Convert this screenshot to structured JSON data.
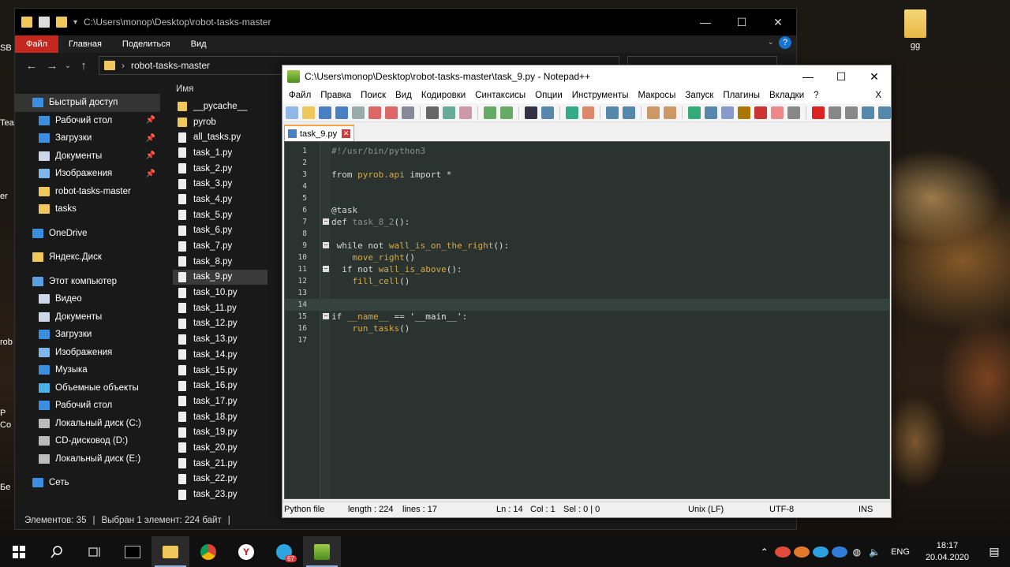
{
  "desktop": {
    "right_icon_label": "gg",
    "edge_labels": [
      "SB",
      "Tea",
      "er",
      "rob",
      "P",
      "Co",
      "Бе"
    ]
  },
  "explorer": {
    "title_path": "C:\\Users\\monop\\Desktop\\robot-tasks-master",
    "ribbon_tabs": [
      "Файл",
      "Главная",
      "Поделиться",
      "Вид"
    ],
    "help_label": "?",
    "address_path": "robot-tasks-master",
    "column_header": "Имя",
    "nav_items": [
      {
        "label": "Быстрый доступ",
        "icon": "star-icon",
        "type": "head",
        "selected": true
      },
      {
        "label": "Рабочий стол",
        "icon": "desktop-icon",
        "pinned": true
      },
      {
        "label": "Загрузки",
        "icon": "download-icon",
        "pinned": true
      },
      {
        "label": "Документы",
        "icon": "documents-icon",
        "pinned": true
      },
      {
        "label": "Изображения",
        "icon": "images-icon",
        "pinned": true
      },
      {
        "label": "robot-tasks-master",
        "icon": "folder-icon"
      },
      {
        "label": "tasks",
        "icon": "folder-icon"
      },
      {
        "label": "OneDrive",
        "icon": "cloud-icon",
        "type": "head",
        "gap": true
      },
      {
        "label": "Яндекс.Диск",
        "icon": "yandex-disk-icon",
        "type": "head",
        "gap": true
      },
      {
        "label": "Этот компьютер",
        "icon": "computer-icon",
        "type": "head",
        "gap": true
      },
      {
        "label": "Видео",
        "icon": "video-icon"
      },
      {
        "label": "Документы",
        "icon": "documents-icon"
      },
      {
        "label": "Загрузки",
        "icon": "download-icon"
      },
      {
        "label": "Изображения",
        "icon": "images-icon"
      },
      {
        "label": "Музыка",
        "icon": "music-icon"
      },
      {
        "label": "Объемные объекты",
        "icon": "3d-objects-icon"
      },
      {
        "label": "Рабочий стол",
        "icon": "desktop-icon"
      },
      {
        "label": "Локальный диск (C:)",
        "icon": "drive-icon"
      },
      {
        "label": "CD-дисковод (D:)",
        "icon": "cd-drive-icon"
      },
      {
        "label": "Локальный диск (E:)",
        "icon": "drive-icon"
      },
      {
        "label": "Сеть",
        "icon": "network-icon",
        "type": "head",
        "gap": true
      }
    ],
    "files": [
      {
        "name": "__pycache__",
        "type": "folder"
      },
      {
        "name": "pyrob",
        "type": "folder"
      },
      {
        "name": "all_tasks.py",
        "type": "file"
      },
      {
        "name": "task_1.py",
        "type": "file"
      },
      {
        "name": "task_2.py",
        "type": "file"
      },
      {
        "name": "task_3.py",
        "type": "file"
      },
      {
        "name": "task_4.py",
        "type": "file"
      },
      {
        "name": "task_5.py",
        "type": "file"
      },
      {
        "name": "task_6.py",
        "type": "file"
      },
      {
        "name": "task_7.py",
        "type": "file"
      },
      {
        "name": "task_8.py",
        "type": "file"
      },
      {
        "name": "task_9.py",
        "type": "file",
        "selected": true
      },
      {
        "name": "task_10.py",
        "type": "file"
      },
      {
        "name": "task_11.py",
        "type": "file"
      },
      {
        "name": "task_12.py",
        "type": "file"
      },
      {
        "name": "task_13.py",
        "type": "file"
      },
      {
        "name": "task_14.py",
        "type": "file"
      },
      {
        "name": "task_15.py",
        "type": "file"
      },
      {
        "name": "task_16.py",
        "type": "file"
      },
      {
        "name": "task_17.py",
        "type": "file"
      },
      {
        "name": "task_18.py",
        "type": "file"
      },
      {
        "name": "task_19.py",
        "type": "file"
      },
      {
        "name": "task_20.py",
        "type": "file"
      },
      {
        "name": "task_21.py",
        "type": "file"
      },
      {
        "name": "task_22.py",
        "type": "file"
      },
      {
        "name": "task_23.py",
        "type": "file"
      }
    ],
    "status_count": "Элементов: 35",
    "status_selected": "Выбран 1 элемент: 224 байт"
  },
  "npp": {
    "title": "C:\\Users\\monop\\Desktop\\robot-tasks-master\\task_9.py - Notepad++",
    "menu": [
      "Файл",
      "Правка",
      "Поиск",
      "Вид",
      "Кодировки",
      "Синтаксисы",
      "Опции",
      "Инструменты",
      "Макросы",
      "Запуск",
      "Плагины",
      "Вкладки",
      "?"
    ],
    "menu_close": "X",
    "tab_label": "task_9.py",
    "code_lines": [
      {
        "n": "1",
        "text": "#!/usr/bin/python3",
        "cls": "c-gray"
      },
      {
        "n": "2",
        "text": ""
      },
      {
        "n": "3",
        "text": "from pyrob.api import *",
        "html": "from <span class='c-fn'>pyrob.api</span> import *"
      },
      {
        "n": "4",
        "text": ""
      },
      {
        "n": "5",
        "text": ""
      },
      {
        "n": "6",
        "text": "@task"
      },
      {
        "n": "7",
        "text": "def task_8_2():",
        "fold": true,
        "html": "def <span class='c-gray'>task_8_2</span>():"
      },
      {
        "n": "8",
        "text": ""
      },
      {
        "n": "9",
        "text": " while not wall_is_on_the_right():",
        "fold": true,
        "html": " while not <span class='c-fn'>wall_is_on_the_right</span>():"
      },
      {
        "n": "10",
        "text": "    move_right()",
        "html": "    <span class='c-fn'>move_right</span>()"
      },
      {
        "n": "11",
        "text": "  if not wall_is_above():",
        "fold": true,
        "html": "  if not <span class='c-fn'>wall_is_above</span>():"
      },
      {
        "n": "12",
        "text": "    fill_cell()",
        "html": "    <span class='c-fn'>fill_cell</span>()"
      },
      {
        "n": "13",
        "text": ""
      },
      {
        "n": "14",
        "text": "",
        "current": true
      },
      {
        "n": "15",
        "text": "if __name__ == '__main__':",
        "fold": true,
        "html": "if <span class='c-fn'>__name__</span> == <span class='c-str'>'__main__'</span>:"
      },
      {
        "n": "16",
        "text": "    run_tasks()",
        "html": "    <span class='c-fn'>run_tasks</span>()"
      },
      {
        "n": "17",
        "text": ""
      }
    ],
    "status": {
      "type": "Python file",
      "length": "length : 224",
      "lines": "lines : 17",
      "ln": "Ln : 14",
      "col": "Col : 1",
      "sel": "Sel : 0 | 0",
      "eol": "Unix (LF)",
      "encoding": "UTF-8",
      "mode": "INS"
    }
  },
  "taskbar": {
    "language": "ENG",
    "time": "18:17",
    "date": "20.04.2020",
    "badge": "67"
  }
}
